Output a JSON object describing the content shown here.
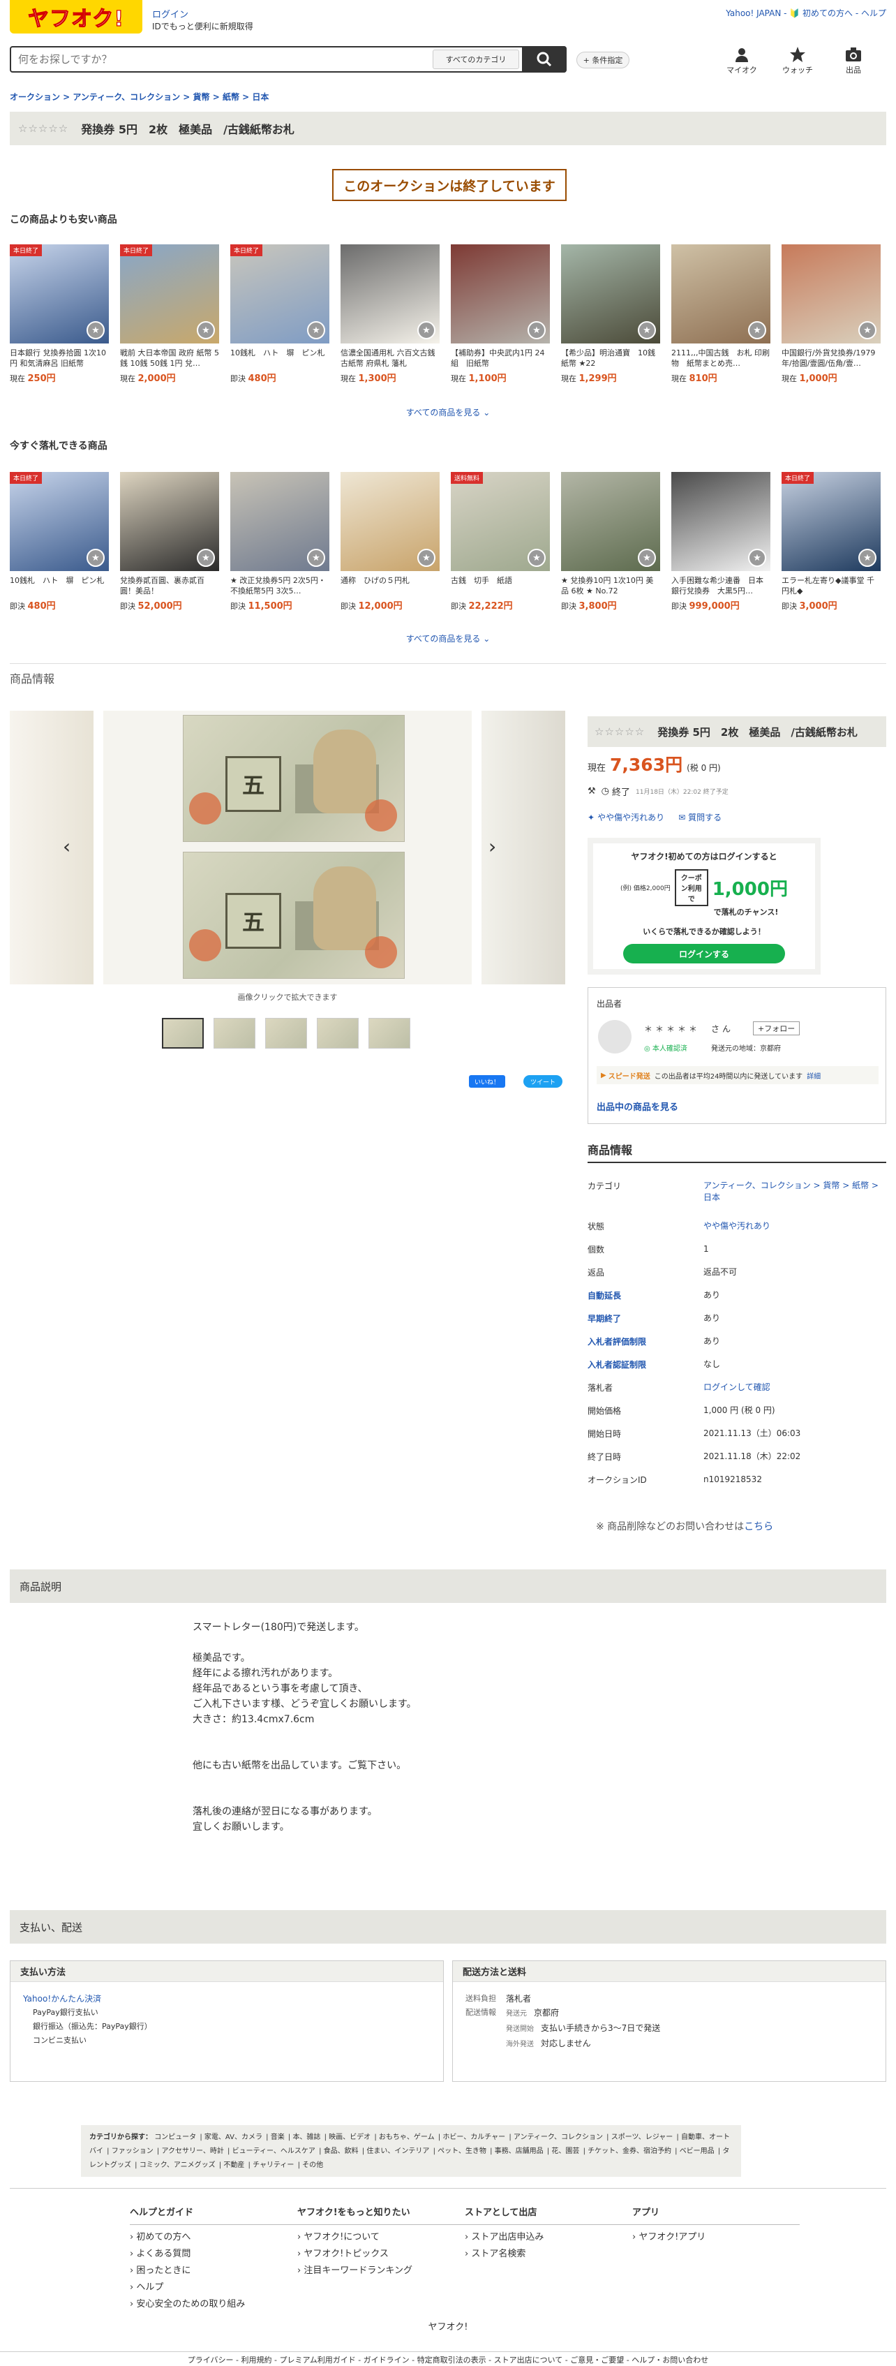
{
  "header": {
    "logo": "ヤフオク!",
    "login": "ログイン",
    "login_sub": "IDでもっと便利に新規取得",
    "top_links": "Yahoo! JAPAN - 🔰 初めての方へ - ヘルプ",
    "search_placeholder": "何をお探しですか？",
    "search_category": "すべてのカテゴリ",
    "cond_button": "+ 条件指定",
    "icons": [
      {
        "label": "マイオク",
        "icon": "person-icon"
      },
      {
        "label": "ウォッチ",
        "icon": "star-icon"
      },
      {
        "label": "出品",
        "icon": "camera-icon"
      }
    ]
  },
  "breadcrumb": "オークション > アンティーク、コレクション > 貨幣 > 紙幣 > 日本",
  "title": {
    "stars": "☆☆☆☆☆",
    "text": "発換券 5円　2枚　極美品　/古銭紙幣お札"
  },
  "ended": "このオークションは終了しています",
  "cheaper": {
    "heading": "この商品よりも安い商品",
    "more": "すべての商品を見る",
    "items": [
      {
        "badge": "本日終了",
        "title": "日本銀行 兌換券拾圓 1次10円 和気清麻呂 旧紙幣",
        "price_label": "現在",
        "price": "250円"
      },
      {
        "badge": "本日終了",
        "title": "戦前 大日本帝国 政府 紙幣 5銭 10銭 50銭 1円 兌…",
        "price_label": "現在",
        "price": "2,000円"
      },
      {
        "badge": "本日終了",
        "title": "10銭札　ハト　塀　ピン札",
        "price_label": "即決",
        "price": "480円"
      },
      {
        "badge": "",
        "title": "信濃全国通用札 六百文古銭 古紙幣 府県札 藩札",
        "price_label": "現在",
        "price": "1,300円"
      },
      {
        "badge": "",
        "title": "【補助券】中央武内1円 24組　旧紙幣",
        "price_label": "現在",
        "price": "1,100円"
      },
      {
        "badge": "",
        "title": "【希少品】明治通寶　10銭　紙幣 ★22",
        "price_label": "現在",
        "price": "1,299円"
      },
      {
        "badge": "",
        "title": "2111,,,中国古銭　お札 印刷物　紙幣まとめ売…",
        "price_label": "現在",
        "price": "810円"
      },
      {
        "badge": "",
        "title": "中国銀行/外貨兌換券/1979年/拾圓/壹圓/伍角/壹…",
        "price_label": "現在",
        "price": "1,000円"
      }
    ]
  },
  "buynow": {
    "heading": "今すぐ落札できる商品",
    "more": "すべての商品を見る",
    "items": [
      {
        "badge": "本日終了",
        "title": "10銭札　ハト　塀　ピン札",
        "price_label": "即決",
        "price": "480円"
      },
      {
        "badge": "",
        "title": "兌換券貳百圓、裏赤貳百圓！美品！",
        "price_label": "即決",
        "price": "52,000円"
      },
      {
        "badge": "",
        "title": "★ 改正兌換券5円 2次5円・不換紙幣5円 3次5…",
        "price_label": "即決",
        "price": "11,500円"
      },
      {
        "badge": "",
        "title": "通称　ひげの５円札",
        "price_label": "即決",
        "price": "12,000円"
      },
      {
        "badge": "送料無料",
        "title": "古銭　切手　紙語",
        "price_label": "即決",
        "price": "22,222円"
      },
      {
        "badge": "",
        "title": "★ 兌換券10円 1次10円 美品 6枚 ★ No.72",
        "price_label": "即決",
        "price": "3,800円"
      },
      {
        "badge": "",
        "title": "入手困難な希少連番　日本銀行兌換券　大黒5円…",
        "price_label": "即決",
        "price": "999,000円"
      },
      {
        "badge": "本日終了",
        "title": "エラー札左寄り◆議事堂 千円札◆",
        "price_label": "即決",
        "price": "3,000円"
      }
    ]
  },
  "product": {
    "section_heading": "商品情報",
    "zoom_caption": "画像クリックで拡大できます",
    "bill_value": "五",
    "share_like": "いいね！",
    "share_tweet": "ツイート",
    "side_stars": "☆☆☆☆☆",
    "side_title": "発換券 5円　2枚　極美品　/古銭紙幣お札",
    "price_label": "現在",
    "price": "7,363円",
    "tax": "(税 0 円)",
    "status": "終了",
    "end_small": "11月18日（木）22:02 終了予定",
    "condition": "やや傷や汚れあり",
    "question": "質問する",
    "promo": {
      "line1": "ヤフオク!初めての方はログインすると",
      "example": "(例) 価格2,000円",
      "coupon": "クーポン利用で",
      "amount": "1,000円",
      "chance": "で落札のチャンス!",
      "check": "いくらで落札できるか確認しよう！",
      "btn": "ログインする"
    },
    "seller": {
      "heading": "出品者",
      "name": "＊＊＊＊＊　さん",
      "follow": "+フォロー",
      "verified": "本人確認済",
      "ship_from": "発送元の地域：京都府",
      "speed_tag": "スピード発送",
      "speed_text": "この出品者は平均24時間以内に発送しています",
      "detail": "詳細",
      "items": "出品中の商品を見る"
    },
    "info_heading": "商品情報",
    "rows": [
      {
        "k": "カテゴリ",
        "v": "アンティーク、コレクション > 貨幣 > 紙幣 > 日本",
        "vlink": true,
        "klink": false
      },
      {
        "k": "状態",
        "v": "やや傷や汚れあり",
        "vlink": true,
        "klink": false
      },
      {
        "k": "個数",
        "v": "1",
        "vlink": false,
        "klink": false
      },
      {
        "k": "返品",
        "v": "返品不可",
        "vlink": false,
        "klink": false
      },
      {
        "k": "自動延長",
        "v": "あり",
        "vlink": false,
        "klink": true
      },
      {
        "k": "早期終了",
        "v": "あり",
        "vlink": false,
        "klink": true
      },
      {
        "k": "入札者評価制限",
        "v": "あり",
        "vlink": false,
        "klink": true
      },
      {
        "k": "入札者認証制限",
        "v": "なし",
        "vlink": false,
        "klink": true
      },
      {
        "k": "落札者",
        "v": "ログインして確認",
        "vlink": true,
        "klink": false
      },
      {
        "k": "開始価格",
        "v": "1,000 円 (税 0 円)",
        "vlink": false,
        "klink": false
      },
      {
        "k": "開始日時",
        "v": "2021.11.13（土）06:03",
        "vlink": false,
        "klink": false
      },
      {
        "k": "終了日時",
        "v": "2021.11.18（木）22:02",
        "vlink": false,
        "klink": false
      },
      {
        "k": "オークションID",
        "v": "n1019218532",
        "vlink": false,
        "klink": false
      }
    ],
    "contact_pre": "※ 商品削除などのお問い合わせは",
    "contact_link": "こちら"
  },
  "description": {
    "heading": "商品説明",
    "text": "スマートレター(180円)で発送します。\n\n極美品です。\n経年による擦れ汚れがあります。\n経年品であるという事を考慮して頂き、\nご入札下さいます様、どうぞ宜しくお願いします。\n大きさ：約13.4cmx7.6cm\n\n\n他にも古い紙幣を出品しています。ご覧下さい。\n\n\n落札後の連絡が翌日になる事があります。\n宜しくお願いします。"
  },
  "payment": {
    "heading": "支払い、配送",
    "pay_title": "支払い方法",
    "pay_main": "Yahoo!かんたん決済",
    "pay_items": [
      "PayPay銀行支払い",
      "銀行振込（振込先：PayPay銀行）",
      "コンビニ支払い"
    ],
    "ship_title": "配送方法と送料",
    "ship_payer_k": "送料負担",
    "ship_payer_v": "落札者",
    "ship_info_k": "配送情報",
    "ship_from_k": "発送元",
    "ship_from_v": "京都府",
    "ship_start_k": "発送開始",
    "ship_start_v": "支払い手続きから3～7日で発送",
    "ship_abroad_k": "海外発送",
    "ship_abroad_v": "対応しません"
  },
  "categories": {
    "label": "カテゴリから探す：",
    "items": [
      "コンピュータ",
      "家電、AV、カメラ",
      "音楽",
      "本、雑誌",
      "映画、ビデオ",
      "おもちゃ、ゲーム",
      "ホビー、カルチャー",
      "アンティーク、コレクション",
      "スポーツ、レジャー",
      "自動車、オートバイ",
      "ファッション",
      "アクセサリー、時計",
      "ビューティー、ヘルスケア",
      "食品、飲料",
      "住まい、インテリア",
      "ペット、生き物",
      "事務、店舗用品",
      "花、園芸",
      "チケット、金券、宿泊予約",
      "ベビー用品",
      "タレントグッズ",
      "コミック、アニメグッズ",
      "不動産",
      "チャリティー",
      "その他"
    ]
  },
  "footer": {
    "cols": [
      {
        "h": "ヘルプとガイド",
        "items": [
          "› 初めての方へ",
          "› よくある質問",
          "› 困ったときに",
          "› ヘルプ",
          "› 安心安全のための取り組み"
        ]
      },
      {
        "h": "ヤフオク!をもっと知りたい",
        "items": [
          "› ヤフオク!について",
          "› ヤフオク!トピックス",
          "› 注目キーワードランキング"
        ]
      },
      {
        "h": "ストアとして出店",
        "items": [
          "› ストア出店申込み",
          "› ストア名検索"
        ]
      },
      {
        "h": "アプリ",
        "items": [
          "› ヤフオク!アプリ"
        ]
      }
    ],
    "brand": "ヤフオク!",
    "links": "プライバシー - 利用規約 - プレミアム利用ガイド - ガイドライン - 特定商取引法の表示 - ストア出店について - ご意見・ご要望 - ヘルプ・お問い合わせ"
  },
  "colors": {
    "brand_yellow": "#ffd700",
    "price_orange": "#d9541f",
    "link_blue": "#2257b0",
    "ended_brown": "#994c00",
    "green": "#17b04f"
  }
}
